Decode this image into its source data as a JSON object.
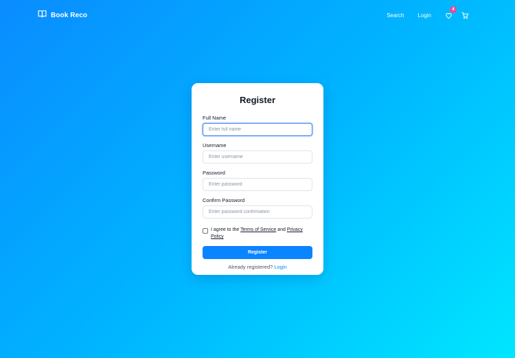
{
  "header": {
    "brand": "Book Reco",
    "nav": {
      "search": "Search",
      "login": "Login"
    },
    "wishlist_count": "4",
    "icons": {
      "brand": "book-open-icon",
      "wishlist": "heart-icon",
      "cart": "cart-icon"
    }
  },
  "form": {
    "title": "Register",
    "fields": [
      {
        "label": "Full Name",
        "placeholder": "Enter full name",
        "value": ""
      },
      {
        "label": "Username",
        "placeholder": "Enter username",
        "value": ""
      },
      {
        "label": "Password",
        "placeholder": "Enter password",
        "value": ""
      },
      {
        "label": "Confirm Password",
        "placeholder": "Enter password confirmation",
        "value": ""
      }
    ],
    "agree": {
      "prefix": "I agree to the",
      "terms": "Terms of Service",
      "and": "and",
      "privacy": "Privacy Policy",
      "checked": false
    },
    "submit": "Register",
    "footer": {
      "text": "Already registered?",
      "link": "Login"
    }
  },
  "colors": {
    "gradient_start": "#0a8cff",
    "gradient_end": "#00e6ff",
    "primary": "#0a84ff",
    "badge": "#ec4899"
  }
}
